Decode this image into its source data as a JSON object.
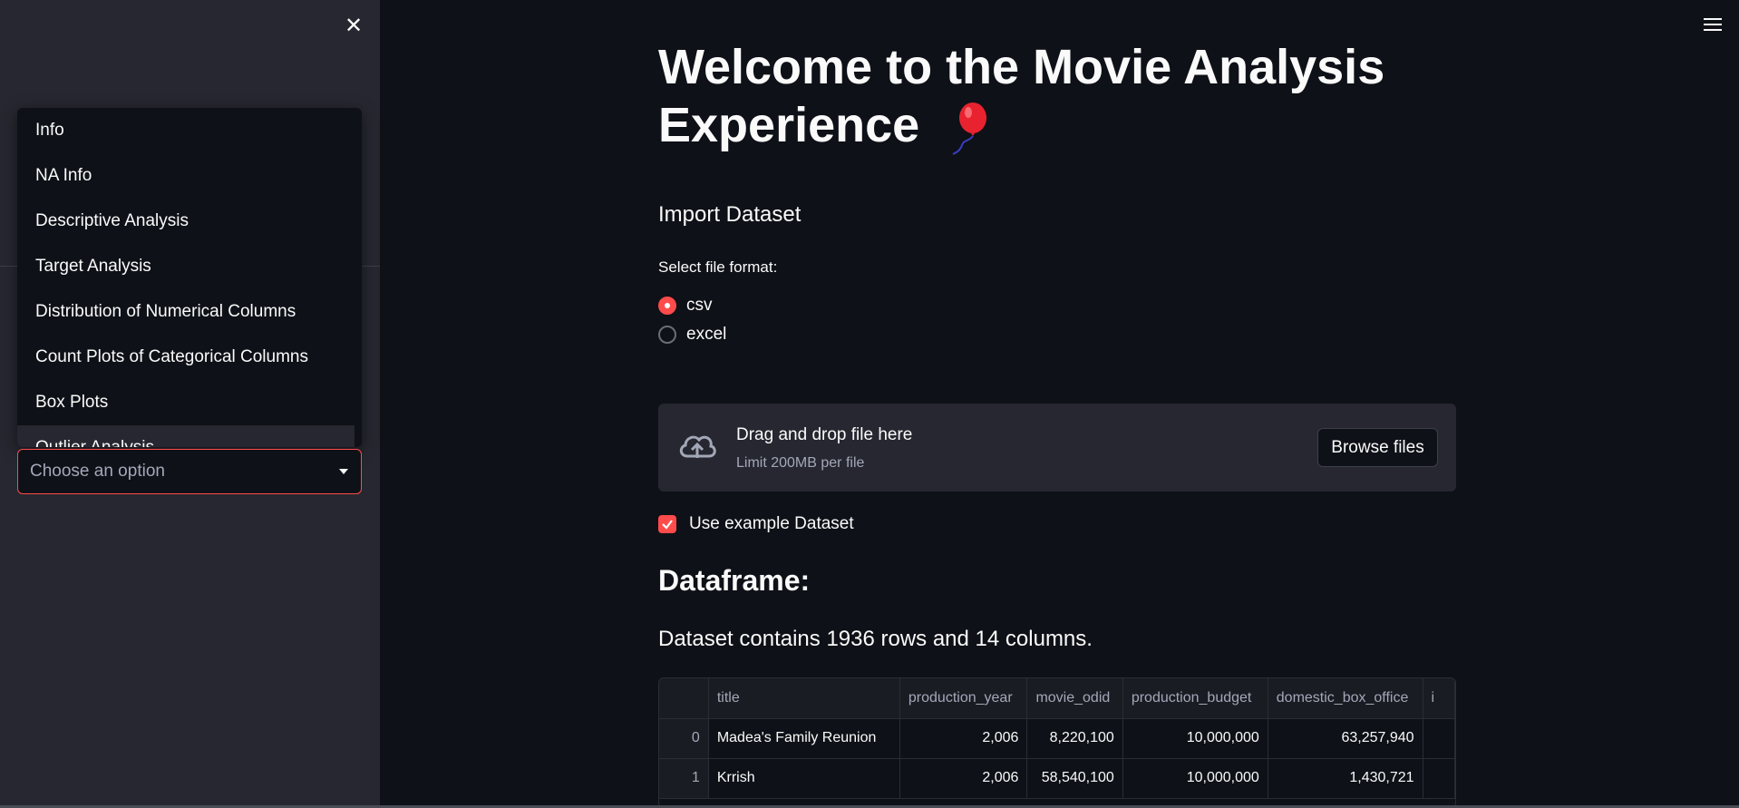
{
  "sidebar": {
    "close_icon": "close-icon",
    "dropdown": {
      "items": [
        "Info",
        "NA Info",
        "Descriptive Analysis",
        "Target Analysis",
        "Distribution of Numerical Columns",
        "Count Plots of Categorical Columns",
        "Box Plots",
        "Outlier Analysis"
      ]
    },
    "select": {
      "placeholder": "Choose an option"
    }
  },
  "header": {
    "menu_icon": "hamburger-menu-icon"
  },
  "main": {
    "title": "Welcome to the Movie Analysis Experience",
    "title_emoji": "balloon-icon",
    "import_title": "Import Dataset",
    "format_label": "Select file format:",
    "formats": [
      {
        "label": "csv",
        "selected": true
      },
      {
        "label": "excel",
        "selected": false
      }
    ],
    "uploader": {
      "title": "Drag and drop file here",
      "limit": "Limit 200MB per file",
      "button": "Browse files",
      "icon": "cloud-upload-icon"
    },
    "example_checkbox": {
      "label": "Use example Dataset",
      "checked": true
    },
    "dataframe_title": "Dataframe:",
    "dataset_info": "Dataset contains 1936 rows and 14 columns.",
    "table": {
      "columns": [
        "",
        "title",
        "production_year",
        "movie_odid",
        "production_budget",
        "domestic_box_office",
        "i"
      ],
      "rows": [
        [
          "0",
          "Madea's Family Reunion",
          "2,006",
          "8,220,100",
          "10,000,000",
          "63,257,940",
          ""
        ],
        [
          "1",
          "Krrish",
          "2,006",
          "58,540,100",
          "10,000,000",
          "1,430,721",
          ""
        ]
      ]
    }
  },
  "colors": {
    "accent": "#ff4b4b",
    "background": "#0e1117",
    "sidebar": "#262730"
  }
}
